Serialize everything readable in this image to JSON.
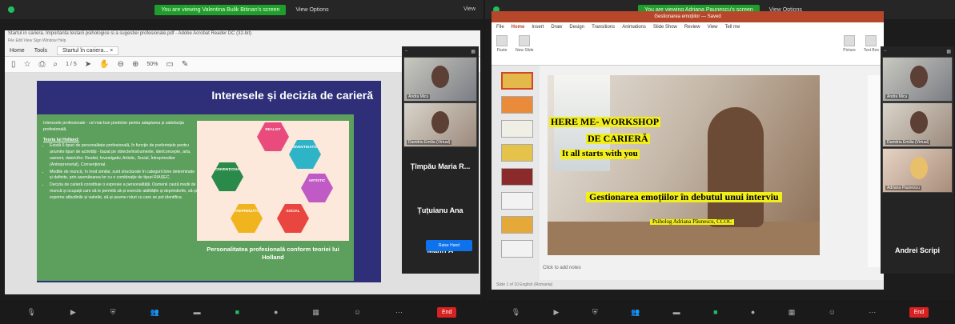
{
  "left": {
    "banner": "You are viewing Valentina Bulik Bitinan's screen",
    "view_options": "View Options",
    "view_label": "View",
    "acrobat_title": "Startul in cariera. Importanta testarii psihologice si a sugestiei profesionale.pdf - Adobe Acrobat Reader DC (32-bit)",
    "acrobat_menu": "File Edit View Sign Window Help",
    "tab_home": "Home",
    "tab_tools": "Tools",
    "tab_doc": "Startul în cariera... ×",
    "page_counter": "1 / 5",
    "zoom": "50%",
    "slide_title": "Interesele și decizia de carieră",
    "intro": "Interesele profesionale - cel mai bun predictor pentru adaptarea și satisfacția profesională.",
    "theory_heading": "Teoria lui Holland:",
    "bullet1": "Există 6 tipuri de personalitate profesională, în funcție de preferințele pentru anumite tipuri de activități - bazat pe obiecte/instrumente, idei/concepte, arta, oameni, date/cifre: Realist, Investigativ, Artistic, Social, Întreprinzător (Antreprenorial), Convențional.",
    "bullet2": "Mediile de muncă, în mod similar, sunt structurate în categorii bine determinate și definite, prin asemănarea lor cu o combinație de tipuri RIASEC.",
    "bullet3": "Decizia de carieră constituie o expresie a personalității. Oamenii caută medii de muncă și ocupații care să le permită să-și exercite abilitățile și deprinderile, să-și exprime atitudinile și valorile, să-și asume roluri cu care se pot identifica.",
    "hex_realist": "REALIST",
    "hex_investigativ": "INVESTIGATIV",
    "hex_artistic": "ARTISTIC",
    "hex_social": "SOCIAL",
    "hex_intreprinzator": "ÎNTREPRINZĂTOR",
    "hex_conventional": "CONVENȚIONAL",
    "caption": "Personalitatea profesională conform teoriei lui Holland",
    "raise_hand": "Raise Hand",
    "participant_1": "Andra Micu",
    "participant_2": "Dumitriu Emilia (Virtual)",
    "participant_3": "Țîmpău Maria R...",
    "participant_4": "Țuțuianu Ana",
    "participant_5": "Mahri A",
    "end": "End"
  },
  "right": {
    "banner": "You are viewing Adriana Paunescu's screen",
    "view_options": "View Options",
    "ppt_title": "Gestionarea emoțiilor — Saved",
    "tabs": [
      "File",
      "Home",
      "Insert",
      "Draw",
      "Design",
      "Transitions",
      "Animations",
      "Slide Show",
      "Review",
      "View",
      "Tell me"
    ],
    "rib_paste": "Paste",
    "rib_new": "New Slide",
    "rib_picture": "Picture",
    "rib_textbox": "Text Box",
    "line1": "HERE ME- WORKSHOP",
    "line2": "DE CARIERĂ",
    "line3": "It all starts with you",
    "subtitle": "Gestionarea emoțiilor în debutul unui interviu",
    "author": "Psiholog Adriana Păunescu, CCOC",
    "notes": "Click to add notes",
    "status": "Slide 1 of 10   English (Romania)",
    "participant_1": "Andra Micu",
    "participant_2": "Dumitriu Emilia (Virtual)",
    "participant_3": "Adriana Paunescu",
    "participant_4": "Andrei Scripi",
    "end": "End"
  },
  "colors": {
    "zoom_green": "#1f9e2d",
    "slide_navy": "#2e2f78",
    "slide_green": "#5d9f5c",
    "ppt_orange": "#b7472a",
    "yellow": "#f2ee1a",
    "end_red": "#d82121"
  }
}
